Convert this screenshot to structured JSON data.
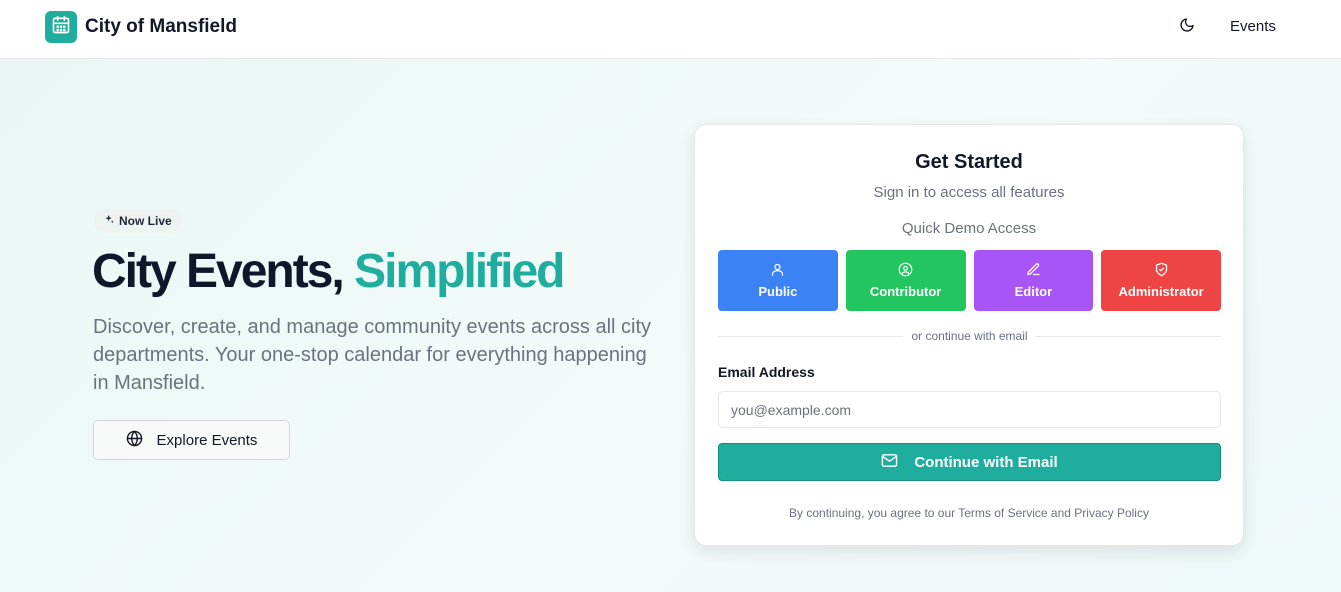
{
  "nav": {
    "brand": "City of Mansfield",
    "logo_icon": "calendar-icon",
    "theme_icon": "moon-icon",
    "events_link": "Events"
  },
  "hero": {
    "badge": "Now Live",
    "badge_icon": "sparkles-icon",
    "title_main": "City Events,",
    "title_accent": "Simplified",
    "description": "Discover, create, and manage community events across all city departments. Your one-stop calendar for everything happening in Mansfield.",
    "explore_button": "Explore Events",
    "explore_icon": "globe-icon"
  },
  "card": {
    "title": "Get Started",
    "subtitle": "Sign in to access all features",
    "demo_label": "Quick Demo Access",
    "roles": [
      {
        "label": "Public",
        "icon": "user-icon",
        "color": "#3b82f6"
      },
      {
        "label": "Contributor",
        "icon": "user-circle-icon",
        "color": "#22c55e"
      },
      {
        "label": "Editor",
        "icon": "pencil-icon",
        "color": "#a855f7"
      },
      {
        "label": "Administrator",
        "icon": "shield-icon",
        "color": "#ef4444"
      }
    ],
    "divider": "or continue with email",
    "email_label": "Email Address",
    "email_placeholder": "you@example.com",
    "email_value": "",
    "continue_button": "Continue with Email",
    "continue_icon": "mail-icon",
    "terms": "By continuing, you agree to our Terms of Service and Privacy Policy"
  },
  "colors": {
    "accent": "#1fae9e",
    "public": "#3b82f6",
    "contributor": "#22c55e",
    "editor": "#a855f7",
    "administrator": "#ef4444"
  }
}
